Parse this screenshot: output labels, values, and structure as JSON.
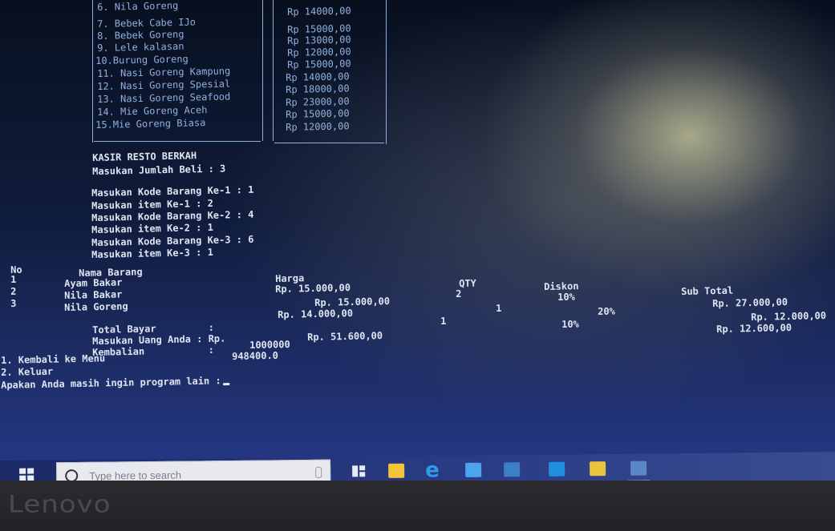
{
  "menu": {
    "items": [
      {
        "name": "6. Nila Goreng",
        "price": "Rp 14000,00"
      },
      {
        "name": "7. Bebek Cabe IJo",
        "price": "Rp 15000,00"
      },
      {
        "name": "8. Bebek Goreng",
        "price": "Rp 13000,00"
      },
      {
        "name": "9. Lele kalasan",
        "price": "Rp 12000,00"
      },
      {
        "name": "10.Burung Goreng",
        "price": "Rp 15000,00"
      },
      {
        "name": "11. Nasi Goreng Kampung",
        "price": "Rp 14000,00"
      },
      {
        "name": "12. Nasi Goreng Spesial",
        "price": "Rp 18000,00"
      },
      {
        "name": "13. Nasi Goreng Seafood",
        "price": "Rp 23000,00"
      },
      {
        "name": "14. Mie Goreng Aceh",
        "price": "Rp 15000,00"
      },
      {
        "name": "15.Mie Goreng Biasa",
        "price": "Rp 12000,00"
      }
    ]
  },
  "cashier": {
    "title": "KASIR RESTO BERKAH",
    "jumlah_beli": "Masukan Jumlah Beli : 3",
    "inputs": [
      "Masukan Kode Barang Ke-1 : 1",
      "Masukan item Ke-1 : 2",
      "Masukan Kode Barang Ke-2 : 4",
      "Masukan item Ke-2 : 1",
      "Masukan Kode Barang Ke-3 : 6",
      "Masukan item Ke-3 : 1"
    ]
  },
  "table": {
    "headers": {
      "no": "No",
      "nama": "Nama Barang",
      "harga": "Harga",
      "qty": "QTY",
      "diskon": "Diskon",
      "subtotal": "Sub Total"
    },
    "rows": [
      {
        "no": "1",
        "nama": "Ayam Bakar",
        "harga": "Rp. 15.000,00",
        "qty": "2",
        "diskon": "10%",
        "subtotal": "Rp. 27.000,00"
      },
      {
        "no": "2",
        "nama": "Nila Bakar",
        "harga": "Rp. 15.000,00",
        "qty": "1",
        "diskon": "20%",
        "subtotal": "Rp. 12.000,00"
      },
      {
        "no": "3",
        "nama": "Nila Goreng",
        "harga": "Rp. 14.000,00",
        "qty": "1",
        "diskon": "10%",
        "subtotal": "Rp. 12.600,00"
      }
    ]
  },
  "summary": {
    "total_label": "Total Bayar         :",
    "total_value": "Rp. 51.600,00",
    "uang_label": "Masukan Uang Anda : Rp.",
    "uang_value": "1000000",
    "kembalian_label": "Kembalian           :",
    "kembalian_value": "948400.0"
  },
  "options": [
    "1. Kembali ke Menu",
    "2. Keluar"
  ],
  "prompt": "Apakan Anda masih ingin program lain :",
  "taskbar": {
    "search_placeholder": "Type here to search",
    "icons": [
      "windows-start-icon",
      "task-view-icon",
      "file-explorer-icon",
      "edge-icon",
      "mail-icon",
      "store-icon",
      "app-l-icon",
      "sticky-notes-icon",
      "photos-icon"
    ]
  },
  "bezel": {
    "brand": "Lenovo"
  },
  "colors": {
    "console_text": "#dfe5f2",
    "menu_text": "#8fb0e0",
    "taskbar": "#2b3d86"
  }
}
